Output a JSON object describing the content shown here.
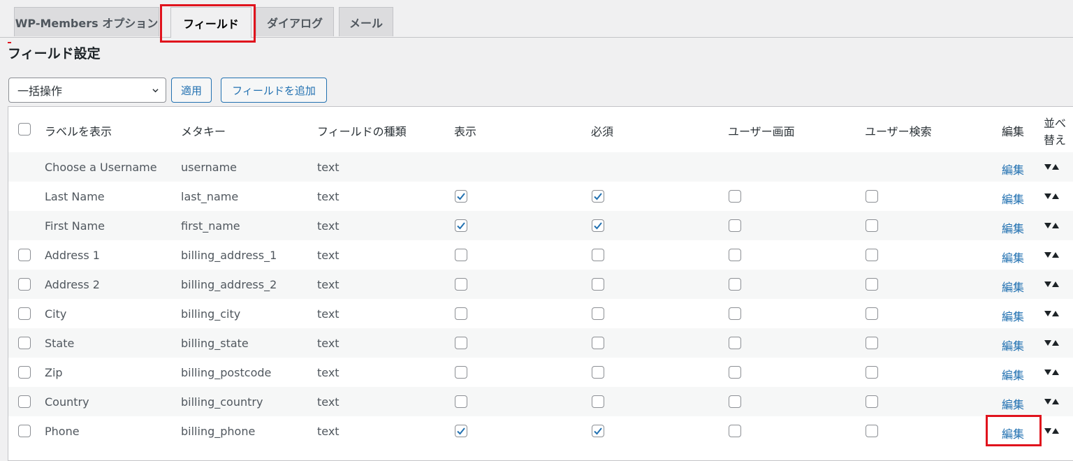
{
  "tabs": [
    "WP-Members オプション",
    "フィールド",
    "ダイアログ",
    "メール"
  ],
  "active_tab": 1,
  "page_title": "フィールド設定",
  "bulk_actions": {
    "selected": "一括操作"
  },
  "apply_button": "適用",
  "add_field_button": "フィールドを追加",
  "columns": {
    "label": "ラベルを表示",
    "meta_key": "メタキー",
    "field_type": "フィールドの種類",
    "display": "表示",
    "required": "必須",
    "user_screen": "ユーザー画面",
    "user_search": "ユーザー検索",
    "edit": "編集",
    "sort_line1": "並べ",
    "sort_line2": "替え"
  },
  "rows": [
    {
      "label": "Choose a Username",
      "meta": "username",
      "type": "text",
      "select": false,
      "display": null,
      "required": null,
      "user_screen": null,
      "user_search": null,
      "edit": "編集"
    },
    {
      "label": "Last Name",
      "meta": "last_name",
      "type": "text",
      "select": false,
      "display": true,
      "required": true,
      "user_screen": false,
      "user_search": false,
      "edit": "編集"
    },
    {
      "label": "First Name",
      "meta": "first_name",
      "type": "text",
      "select": false,
      "display": true,
      "required": true,
      "user_screen": false,
      "user_search": false,
      "edit": "編集"
    },
    {
      "label": "Address 1",
      "meta": "billing_address_1",
      "type": "text",
      "select": true,
      "display": false,
      "required": false,
      "user_screen": false,
      "user_search": false,
      "edit": "編集"
    },
    {
      "label": "Address 2",
      "meta": "billing_address_2",
      "type": "text",
      "select": true,
      "display": false,
      "required": false,
      "user_screen": false,
      "user_search": false,
      "edit": "編集"
    },
    {
      "label": "City",
      "meta": "billing_city",
      "type": "text",
      "select": true,
      "display": false,
      "required": false,
      "user_screen": false,
      "user_search": false,
      "edit": "編集"
    },
    {
      "label": "State",
      "meta": "billing_state",
      "type": "text",
      "select": true,
      "display": false,
      "required": false,
      "user_screen": false,
      "user_search": false,
      "edit": "編集"
    },
    {
      "label": "Zip",
      "meta": "billing_postcode",
      "type": "text",
      "select": true,
      "display": false,
      "required": false,
      "user_screen": false,
      "user_search": false,
      "edit": "編集"
    },
    {
      "label": "Country",
      "meta": "billing_country",
      "type": "text",
      "select": true,
      "display": false,
      "required": false,
      "user_screen": false,
      "user_search": false,
      "edit": "編集"
    },
    {
      "label": "Phone",
      "meta": "billing_phone",
      "type": "text",
      "select": true,
      "display": true,
      "required": true,
      "user_screen": false,
      "user_search": false,
      "edit": "編集"
    }
  ],
  "colors": {
    "accent": "#2271b1",
    "highlight": "#e0131d"
  }
}
